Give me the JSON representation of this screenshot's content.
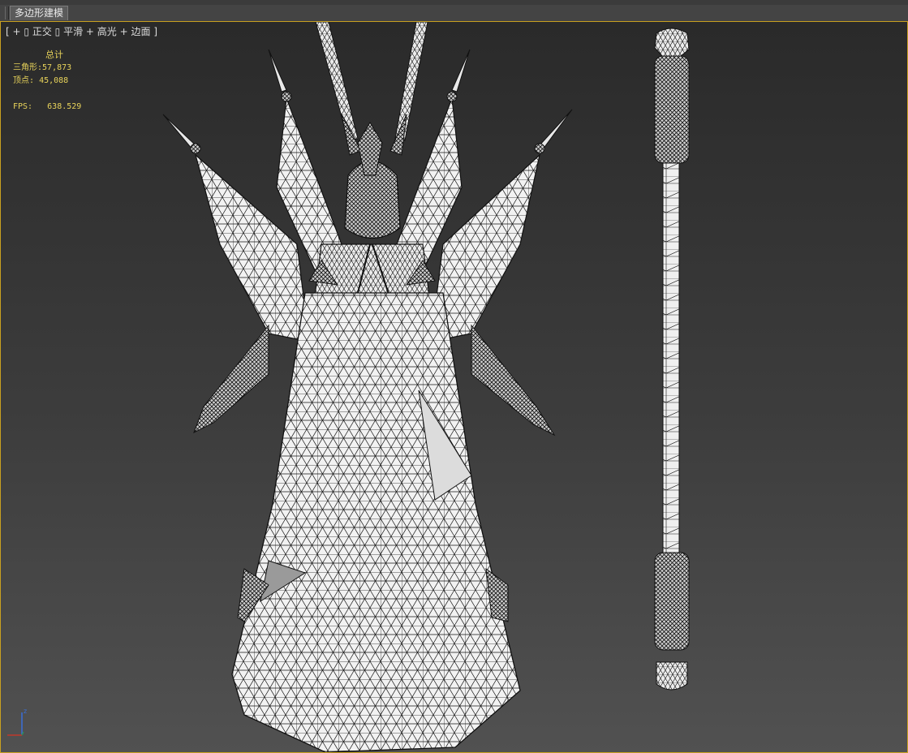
{
  "ribbon": {
    "active_tab": "多边形建模"
  },
  "viewport": {
    "label": {
      "open": "[",
      "plus1": "+",
      "view": "正交",
      "shading": "平滑",
      "plus2": "+",
      "highlights": "高光",
      "plus3": "+",
      "edged": "边面",
      "close": "]"
    },
    "stats": {
      "header": "总计",
      "triangles_label": "三角形:",
      "triangles_value": "57,873",
      "vertices_label": "顶点:",
      "vertices_value": "45,088",
      "fps_label": "FPS:",
      "fps_value": "638.529"
    },
    "axis": {
      "z_label": "z",
      "x_color": "#c0392b",
      "y_color": "#2e8b57",
      "z_color": "#3a6fd8"
    },
    "colors": {
      "border": "#c8a020",
      "stats_text": "#e8d35a",
      "wire": "#111111",
      "surface": "#f2f2f2"
    }
  }
}
